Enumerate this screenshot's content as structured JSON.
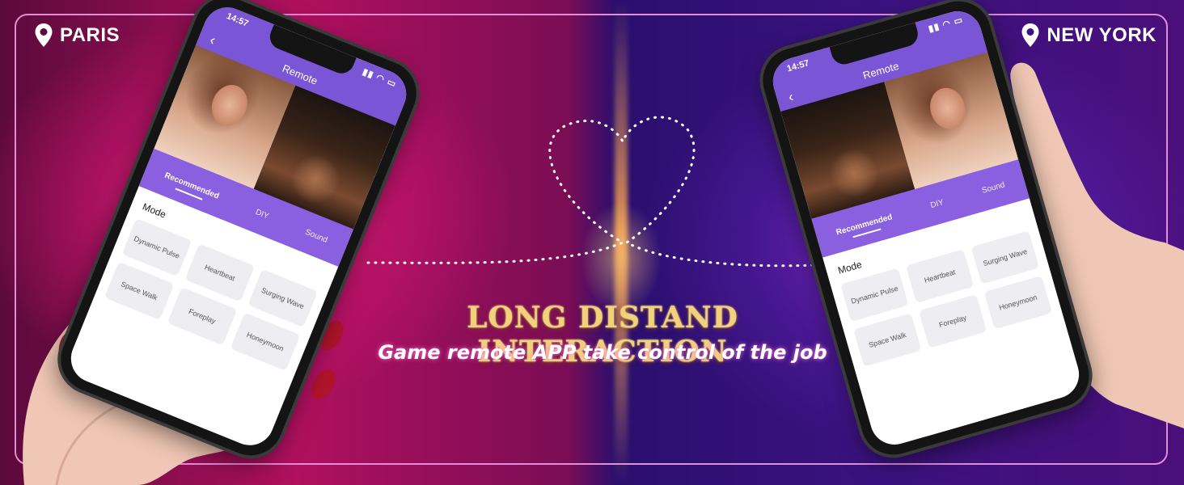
{
  "banner": {
    "location_left": "PARIS",
    "location_right": "NEW YORK",
    "headline": "LONG DISTAND INTERACTION",
    "subline": "Game remote APP take control of the job",
    "pin_icon": "map-pin-icon",
    "colors": {
      "frame": "#e58cd8",
      "headline": "#f3d07a",
      "left_glow": "#ff2f8e",
      "right_glow": "#8e2bd6"
    }
  },
  "phone_left": {
    "time": "14:57",
    "title": "Remote",
    "tabs": [
      "Recommended",
      "DIY",
      "Sound"
    ],
    "mode_label": "Mode",
    "modes": [
      "Dynamic Pulse",
      "Heartbeat",
      "Surging Wave",
      "Space Walk",
      "Foreplay",
      "Honeymoon"
    ]
  },
  "phone_right": {
    "time": "14:57",
    "title": "Remote",
    "tabs": [
      "Recommended",
      "DIY",
      "Sound"
    ],
    "mode_label": "Mode",
    "modes": [
      "Dynamic Pulse",
      "Heartbeat",
      "Surging Wave",
      "Space Walk",
      "Foreplay",
      "Honeymoon"
    ]
  },
  "app_accent": "#7a55d6"
}
